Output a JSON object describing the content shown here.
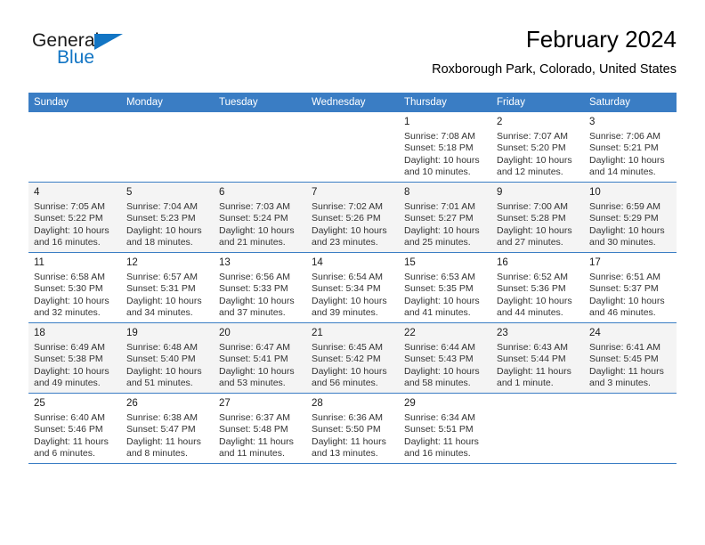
{
  "brand": {
    "name_part1": "General",
    "name_part2": "Blue",
    "flag_icon": "triangle-flag-icon"
  },
  "header": {
    "title": "February 2024",
    "subtitle": "Roxborough Park, Colorado, United States"
  },
  "colors": {
    "header_bar": "#3a7dc4",
    "brand_blue": "#1275c4",
    "alt_row_bg": "#f4f4f4",
    "text": "#333333"
  },
  "weekdays": [
    "Sunday",
    "Monday",
    "Tuesday",
    "Wednesday",
    "Thursday",
    "Friday",
    "Saturday"
  ],
  "weeks": [
    [
      {
        "day": "",
        "info": ""
      },
      {
        "day": "",
        "info": ""
      },
      {
        "day": "",
        "info": ""
      },
      {
        "day": "",
        "info": ""
      },
      {
        "day": "1",
        "info": "Sunrise: 7:08 AM\nSunset: 5:18 PM\nDaylight: 10 hours\nand 10 minutes."
      },
      {
        "day": "2",
        "info": "Sunrise: 7:07 AM\nSunset: 5:20 PM\nDaylight: 10 hours\nand 12 minutes."
      },
      {
        "day": "3",
        "info": "Sunrise: 7:06 AM\nSunset: 5:21 PM\nDaylight: 10 hours\nand 14 minutes."
      }
    ],
    [
      {
        "day": "4",
        "info": "Sunrise: 7:05 AM\nSunset: 5:22 PM\nDaylight: 10 hours\nand 16 minutes."
      },
      {
        "day": "5",
        "info": "Sunrise: 7:04 AM\nSunset: 5:23 PM\nDaylight: 10 hours\nand 18 minutes."
      },
      {
        "day": "6",
        "info": "Sunrise: 7:03 AM\nSunset: 5:24 PM\nDaylight: 10 hours\nand 21 minutes."
      },
      {
        "day": "7",
        "info": "Sunrise: 7:02 AM\nSunset: 5:26 PM\nDaylight: 10 hours\nand 23 minutes."
      },
      {
        "day": "8",
        "info": "Sunrise: 7:01 AM\nSunset: 5:27 PM\nDaylight: 10 hours\nand 25 minutes."
      },
      {
        "day": "9",
        "info": "Sunrise: 7:00 AM\nSunset: 5:28 PM\nDaylight: 10 hours\nand 27 minutes."
      },
      {
        "day": "10",
        "info": "Sunrise: 6:59 AM\nSunset: 5:29 PM\nDaylight: 10 hours\nand 30 minutes."
      }
    ],
    [
      {
        "day": "11",
        "info": "Sunrise: 6:58 AM\nSunset: 5:30 PM\nDaylight: 10 hours\nand 32 minutes."
      },
      {
        "day": "12",
        "info": "Sunrise: 6:57 AM\nSunset: 5:31 PM\nDaylight: 10 hours\nand 34 minutes."
      },
      {
        "day": "13",
        "info": "Sunrise: 6:56 AM\nSunset: 5:33 PM\nDaylight: 10 hours\nand 37 minutes."
      },
      {
        "day": "14",
        "info": "Sunrise: 6:54 AM\nSunset: 5:34 PM\nDaylight: 10 hours\nand 39 minutes."
      },
      {
        "day": "15",
        "info": "Sunrise: 6:53 AM\nSunset: 5:35 PM\nDaylight: 10 hours\nand 41 minutes."
      },
      {
        "day": "16",
        "info": "Sunrise: 6:52 AM\nSunset: 5:36 PM\nDaylight: 10 hours\nand 44 minutes."
      },
      {
        "day": "17",
        "info": "Sunrise: 6:51 AM\nSunset: 5:37 PM\nDaylight: 10 hours\nand 46 minutes."
      }
    ],
    [
      {
        "day": "18",
        "info": "Sunrise: 6:49 AM\nSunset: 5:38 PM\nDaylight: 10 hours\nand 49 minutes."
      },
      {
        "day": "19",
        "info": "Sunrise: 6:48 AM\nSunset: 5:40 PM\nDaylight: 10 hours\nand 51 minutes."
      },
      {
        "day": "20",
        "info": "Sunrise: 6:47 AM\nSunset: 5:41 PM\nDaylight: 10 hours\nand 53 minutes."
      },
      {
        "day": "21",
        "info": "Sunrise: 6:45 AM\nSunset: 5:42 PM\nDaylight: 10 hours\nand 56 minutes."
      },
      {
        "day": "22",
        "info": "Sunrise: 6:44 AM\nSunset: 5:43 PM\nDaylight: 10 hours\nand 58 minutes."
      },
      {
        "day": "23",
        "info": "Sunrise: 6:43 AM\nSunset: 5:44 PM\nDaylight: 11 hours\nand 1 minute."
      },
      {
        "day": "24",
        "info": "Sunrise: 6:41 AM\nSunset: 5:45 PM\nDaylight: 11 hours\nand 3 minutes."
      }
    ],
    [
      {
        "day": "25",
        "info": "Sunrise: 6:40 AM\nSunset: 5:46 PM\nDaylight: 11 hours\nand 6 minutes."
      },
      {
        "day": "26",
        "info": "Sunrise: 6:38 AM\nSunset: 5:47 PM\nDaylight: 11 hours\nand 8 minutes."
      },
      {
        "day": "27",
        "info": "Sunrise: 6:37 AM\nSunset: 5:48 PM\nDaylight: 11 hours\nand 11 minutes."
      },
      {
        "day": "28",
        "info": "Sunrise: 6:36 AM\nSunset: 5:50 PM\nDaylight: 11 hours\nand 13 minutes."
      },
      {
        "day": "29",
        "info": "Sunrise: 6:34 AM\nSunset: 5:51 PM\nDaylight: 11 hours\nand 16 minutes."
      },
      {
        "day": "",
        "info": ""
      },
      {
        "day": "",
        "info": ""
      }
    ]
  ]
}
